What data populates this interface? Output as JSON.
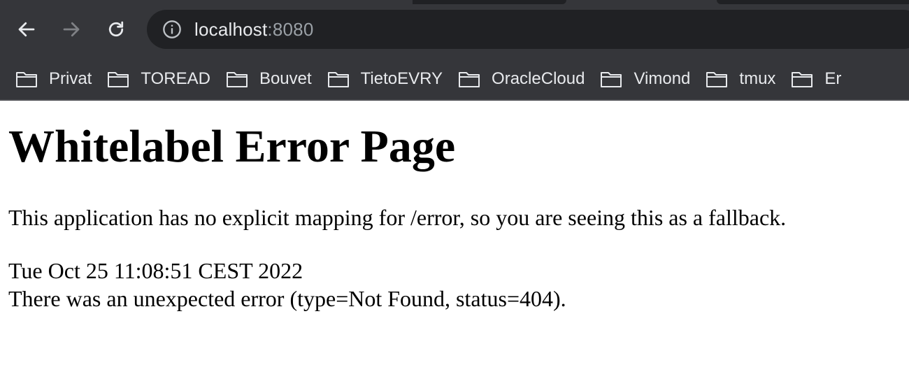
{
  "browser": {
    "url_host": "localhost",
    "url_port": ":8080",
    "icons": {
      "back": "arrow-left-icon",
      "forward": "arrow-right-icon",
      "reload": "reload-icon",
      "info": "info-icon",
      "folder": "folder-icon"
    },
    "colors": {
      "toolbar": "#35363a",
      "omnibox": "#202124",
      "text": "#e8eaed",
      "muted": "#9aa0a6"
    },
    "bookmarks": [
      "Privat",
      "TOREAD",
      "Bouvet",
      "TietoEVRY",
      "OracleCloud",
      "Vimond",
      "tmux",
      "Er"
    ]
  },
  "page": {
    "title": "Whitelabel Error Page",
    "message": "This application has no explicit mapping for /error, so you are seeing this as a fallback.",
    "timestamp": "Tue Oct 25 11:08:51 CEST 2022",
    "error_detail": "There was an unexpected error (type=Not Found, status=404)."
  }
}
